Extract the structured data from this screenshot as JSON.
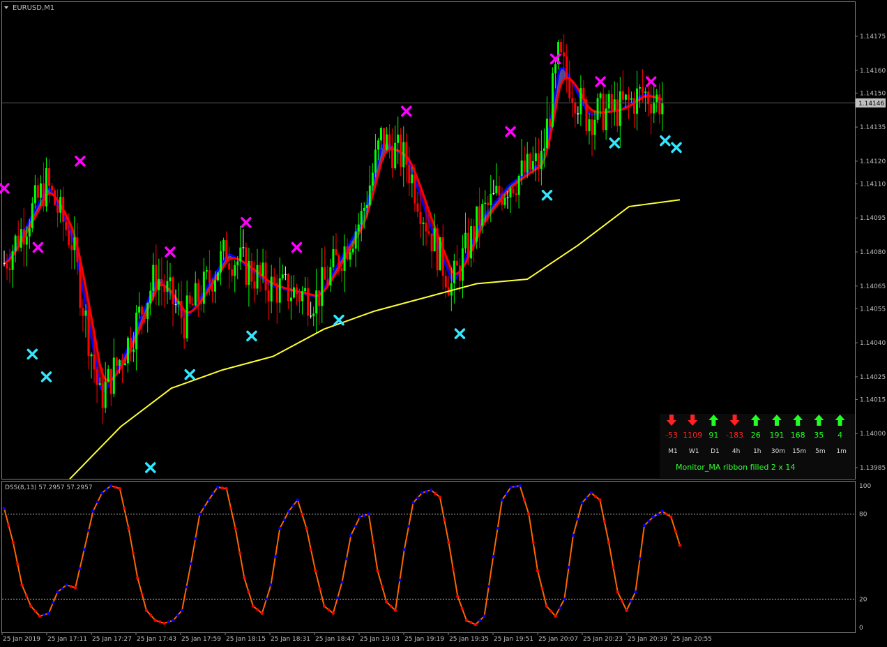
{
  "window": {
    "symbol_label": "EURUSD,M1"
  },
  "colors": {
    "background": "#000000",
    "frame": "#808080",
    "bull_candle": "#00FF00",
    "bear_candle": "#FF0000",
    "doji": "#FFFFFF",
    "ribbon_fast": "#0000FF",
    "ribbon_slow": "#FF0000",
    "ribbon_fill_up": "#5050A0",
    "ribbon_fill_down": "#8B0000",
    "slow_ma": "#FFFF33",
    "sell_marker": "#FF00FF",
    "buy_marker": "#33E6FF",
    "dss_up": "#0000FF",
    "dss_down": "#FF0000",
    "dss_line": "#FF6600",
    "axis_text": "#C0C0C0"
  },
  "price_axis": {
    "ticks": [
      "1.14175",
      "1.14160",
      "1.14150",
      "1.14135",
      "1.14120",
      "1.14110",
      "1.14095",
      "1.14080",
      "1.14065",
      "1.14055",
      "1.14040",
      "1.14025",
      "1.14015",
      "1.14000",
      "1.13985"
    ],
    "current_price": "1.14146"
  },
  "time_axis": {
    "labels": [
      "25 Jan 2019",
      "25 Jan 17:11",
      "25 Jan 17:27",
      "25 Jan 17:43",
      "25 Jan 17:59",
      "25 Jan 18:15",
      "25 Jan 18:31",
      "25 Jan 18:47",
      "25 Jan 19:03",
      "25 Jan 19:19",
      "25 Jan 19:35",
      "25 Jan 19:51",
      "25 Jan 20:07",
      "25 Jan 20:23",
      "25 Jan 20:39",
      "25 Jan 20:55"
    ]
  },
  "monitor": {
    "title": "Monitor_MA ribbon filled 2 x 14",
    "timeframes": [
      {
        "tf": "M1",
        "value": "-53",
        "dir": "down"
      },
      {
        "tf": "W1",
        "value": "1109",
        "dir": "down"
      },
      {
        "tf": "D1",
        "value": "91",
        "dir": "up"
      },
      {
        "tf": "4h",
        "value": "-183",
        "dir": "down"
      },
      {
        "tf": "1h",
        "value": "26",
        "dir": "up"
      },
      {
        "tf": "30m",
        "value": "191",
        "dir": "up"
      },
      {
        "tf": "15m",
        "value": "168",
        "dir": "up"
      },
      {
        "tf": "5m",
        "value": "35",
        "dir": "up"
      },
      {
        "tf": "1m",
        "value": "4",
        "dir": "up"
      }
    ]
  },
  "indicator": {
    "label": "DSS(8,13) 57.2957 57.2957",
    "levels": [
      "100",
      "80",
      "20",
      "0"
    ]
  },
  "chart_data": {
    "type": "line",
    "symbol": "EURUSD",
    "timeframe": "M1",
    "price_range": [
      1.1398,
      1.14185
    ],
    "close_price_path": {
      "x": [
        "16:56",
        "17:11",
        "17:20",
        "17:30",
        "17:40",
        "17:50",
        "18:00",
        "18:15",
        "18:30",
        "18:47",
        "19:03",
        "19:10",
        "19:19",
        "19:27",
        "19:35",
        "19:45",
        "19:55",
        "20:07",
        "20:13",
        "20:23",
        "20:35",
        "20:43",
        "20:50"
      ],
      "y": [
        1.14075,
        1.1411,
        1.14085,
        1.14015,
        1.1404,
        1.1407,
        1.1405,
        1.1408,
        1.14065,
        1.1406,
        1.14095,
        1.1413,
        1.1412,
        1.1409,
        1.14065,
        1.14095,
        1.1411,
        1.1412,
        1.14165,
        1.1414,
        1.14143,
        1.1415,
        1.14146
      ]
    },
    "slow_ma": {
      "name": "slow MA",
      "y": [
        1.1398,
        1.14003,
        1.1402,
        1.14028,
        1.14034,
        1.14046,
        1.14054,
        1.1406,
        1.14066,
        1.14068,
        1.14083,
        1.141,
        1.14103
      ]
    },
    "sell_signals": [
      {
        "x": "16:56",
        "y": 1.14108
      },
      {
        "x": "17:08",
        "y": 1.14082
      },
      {
        "x": "17:23",
        "y": 1.1412
      },
      {
        "x": "17:55",
        "y": 1.1408
      },
      {
        "x": "18:22",
        "y": 1.14093
      },
      {
        "x": "18:40",
        "y": 1.14082
      },
      {
        "x": "19:19",
        "y": 1.14142
      },
      {
        "x": "19:56",
        "y": 1.14133
      },
      {
        "x": "20:12",
        "y": 1.14165
      },
      {
        "x": "20:28",
        "y": 1.14155
      },
      {
        "x": "20:46",
        "y": 1.14155
      }
    ],
    "buy_signals": [
      {
        "x": "17:06",
        "y": 1.14035
      },
      {
        "x": "17:11",
        "y": 1.14025
      },
      {
        "x": "17:48",
        "y": 1.13985
      },
      {
        "x": "18:02",
        "y": 1.14026
      },
      {
        "x": "18:24",
        "y": 1.14043
      },
      {
        "x": "18:55",
        "y": 1.1405
      },
      {
        "x": "19:38",
        "y": 1.14044
      },
      {
        "x": "20:09",
        "y": 1.14105
      },
      {
        "x": "20:33",
        "y": 1.14128
      },
      {
        "x": "20:51",
        "y": 1.14129
      },
      {
        "x": "20:55",
        "y": 1.14126
      }
    ],
    "dss_oscillator": {
      "name": "DSS(8,13)",
      "ylim": [
        0,
        100
      ],
      "levels": [
        80,
        20
      ],
      "values": [
        84,
        60,
        30,
        15,
        8,
        10,
        25,
        30,
        28,
        55,
        82,
        95,
        100,
        98,
        70,
        35,
        12,
        5,
        3,
        5,
        12,
        45,
        80,
        90,
        99,
        98,
        70,
        35,
        15,
        10,
        30,
        70,
        82,
        90,
        70,
        40,
        15,
        10,
        32,
        65,
        78,
        80,
        40,
        18,
        12,
        55,
        88,
        95,
        97,
        92,
        60,
        22,
        5,
        2,
        8,
        50,
        90,
        99,
        100,
        80,
        40,
        15,
        8,
        20,
        65,
        88,
        95,
        90,
        60,
        25,
        12,
        25,
        72,
        78,
        82,
        78,
        58
      ]
    }
  }
}
